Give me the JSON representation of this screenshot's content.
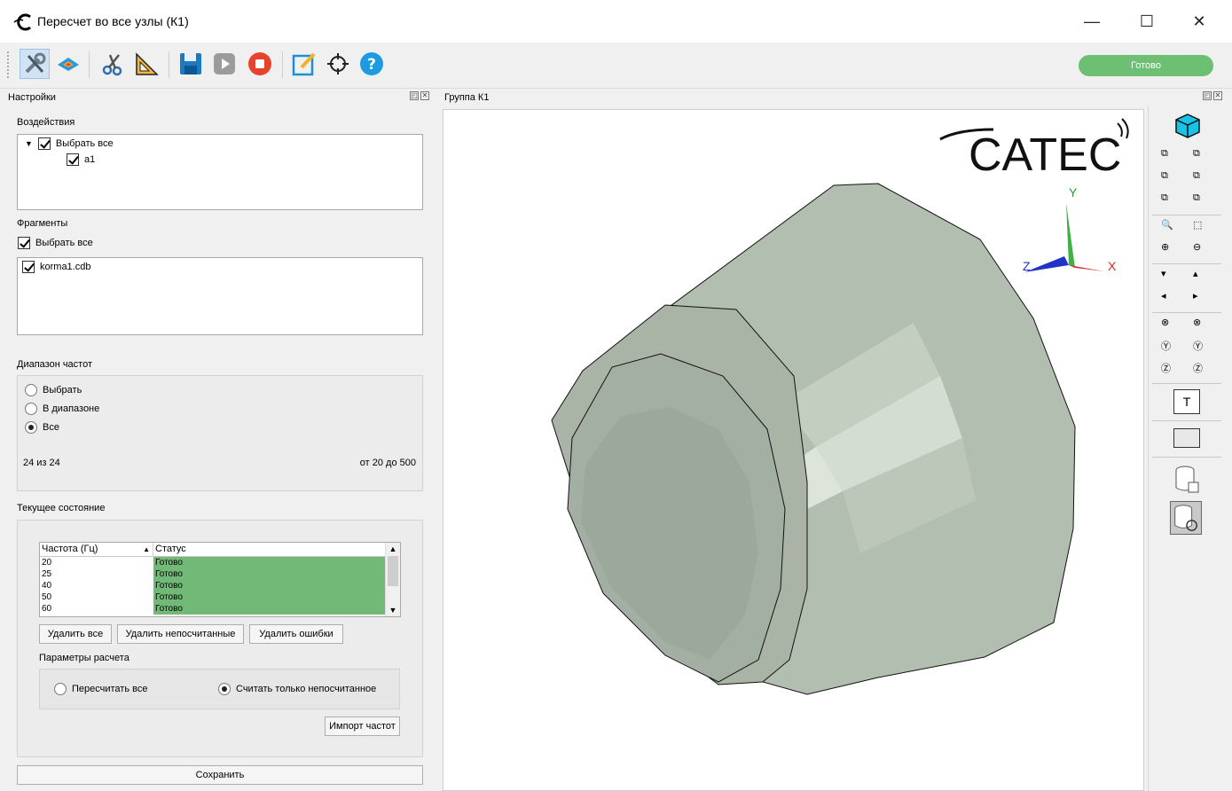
{
  "window": {
    "title": "Пересчет во все узлы (К1)",
    "minimize": "—",
    "maximize": "☐",
    "close": "✕"
  },
  "toolbar": {
    "status_label": "Готово"
  },
  "settings_panel": {
    "title": "Настройки",
    "impacts": {
      "label": "Воздействия",
      "select_all": "Выбрать все",
      "items": [
        "a1"
      ]
    },
    "fragments": {
      "label": "Фрагменты",
      "select_all": "Выбрать все",
      "items": [
        "korma1.cdb"
      ]
    },
    "frequency_range": {
      "label": "Диапазон частот",
      "options": [
        "Выбрать",
        "В диапазоне",
        "Все"
      ],
      "selected": "Все",
      "count_text": "24 из 24",
      "range_text": "от 20 до 500"
    },
    "current_state": {
      "label": "Текущее состояние",
      "columns": [
        "Частота (Гц)",
        "Статус"
      ],
      "rows": [
        {
          "freq": "20",
          "status": "Готово"
        },
        {
          "freq": "25",
          "status": "Готово"
        },
        {
          "freq": "40",
          "status": "Готово"
        },
        {
          "freq": "50",
          "status": "Готово"
        },
        {
          "freq": "60",
          "status": "Готово"
        }
      ],
      "buttons": {
        "delete_all": "Удалить все",
        "delete_uncalculated": "Удалить непосчитанные",
        "delete_errors": "Удалить ошибки"
      },
      "calc_params": {
        "label": "Параметры расчета",
        "options": [
          "Пересчитать все",
          "Считать только непосчитанное"
        ],
        "selected": "Считать только непосчитанное"
      },
      "import_button": "Импорт частот"
    },
    "save_button": "Сохранить"
  },
  "viewport": {
    "title": "Группа К1",
    "logo_text": "CATEC",
    "axes": {
      "x": "X",
      "y": "Y",
      "z": "Z"
    }
  },
  "colors": {
    "status_green": "#72b876",
    "pill_green": "#6cbf73",
    "model_gray": "#b3beb1"
  }
}
